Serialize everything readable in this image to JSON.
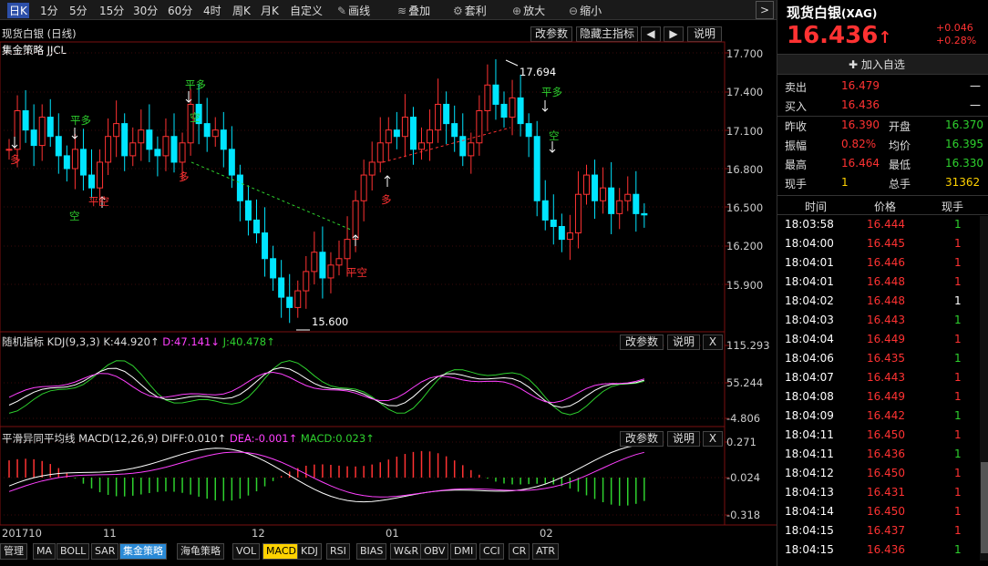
{
  "toolbar": {
    "items": [
      "日K",
      "1分",
      "5分",
      "15分",
      "30分",
      "60分",
      "4时",
      "周K",
      "月K",
      "自定义",
      "画线",
      "叠加",
      "套利",
      "放大",
      "缩小"
    ]
  },
  "title": {
    "name": "现货白银 (日线)",
    "buttons": [
      "改参数",
      "隐藏主指标",
      "◀",
      "▶",
      "说明"
    ]
  },
  "strategy_label": "集金策略 JJCL",
  "price_axis": [
    "17.700",
    "17.400",
    "17.100",
    "16.800",
    "16.500",
    "16.200",
    "15.900"
  ],
  "annotations": {
    "high": "17.694",
    "low": "15.600",
    "pingduo": "平多",
    "pingkong": "平空",
    "duo": "多",
    "kong": "空"
  },
  "kdj": {
    "label": "随机指标",
    "params": "KDJ(9,3,3)",
    "k": "K:44.920↑",
    "d": "D:47.141↓",
    "j": "J:40.478↑",
    "axis": [
      "115.293",
      "55.244",
      "-4.806"
    ],
    "buttons": [
      "改参数",
      "说明",
      "X"
    ]
  },
  "macd": {
    "label": "平滑异同平均线",
    "params": "MACD(12,26,9)",
    "diff": "DIFF:0.010↑",
    "dea": "DEA:-0.001↑",
    "macd": "MACD:0.023↑",
    "axis": [
      "0.271",
      "-0.024",
      "-0.318"
    ],
    "buttons": [
      "改参数",
      "说明",
      "X"
    ]
  },
  "xaxis": [
    "201710",
    "11",
    "12",
    "01",
    "02"
  ],
  "bottom_tabs": [
    "管理",
    "MA",
    "BOLL",
    "SAR",
    "集金策略",
    "海龟策略",
    "VOL",
    "MACD",
    "KDJ",
    "RSI",
    "BIAS",
    "W&R",
    "OBV",
    "DMI",
    "CCI",
    "CR",
    "ATR"
  ],
  "quote": {
    "name": "现货白银",
    "code": "(XAG)",
    "price": "16.436",
    "arrow": "↑",
    "change": "+0.046",
    "pct": "+0.28%",
    "add": "✚ 加入自选",
    "sell_label": "卖出",
    "sell": "16.479",
    "sell_vol": "—",
    "buy_label": "买入",
    "buy": "16.436",
    "buy_vol": "—",
    "stats": [
      [
        "昨收",
        "16.390",
        "开盘",
        "16.370"
      ],
      [
        "振幅",
        "0.82%",
        "均价",
        "16.395"
      ],
      [
        "最高",
        "16.464",
        "最低",
        "16.330"
      ],
      [
        "现手",
        "1",
        "总手",
        "31362"
      ]
    ]
  },
  "ticks_header": [
    "时间",
    "价格",
    "现手"
  ],
  "ticks": [
    [
      "18:03:58",
      "16.444",
      "1"
    ],
    [
      "18:04:00",
      "16.445",
      "1"
    ],
    [
      "18:04:01",
      "16.446",
      "1"
    ],
    [
      "18:04:01",
      "16.448",
      "1"
    ],
    [
      "18:04:02",
      "16.448",
      "1"
    ],
    [
      "18:04:03",
      "16.443",
      "1"
    ],
    [
      "18:04:04",
      "16.449",
      "1"
    ],
    [
      "18:04:06",
      "16.435",
      "1"
    ],
    [
      "18:04:07",
      "16.443",
      "1"
    ],
    [
      "18:04:08",
      "16.449",
      "1"
    ],
    [
      "18:04:09",
      "16.442",
      "1"
    ],
    [
      "18:04:11",
      "16.450",
      "1"
    ],
    [
      "18:04:11",
      "16.436",
      "1"
    ],
    [
      "18:04:12",
      "16.450",
      "1"
    ],
    [
      "18:04:13",
      "16.431",
      "1"
    ],
    [
      "18:04:14",
      "16.450",
      "1"
    ],
    [
      "18:04:15",
      "16.437",
      "1"
    ],
    [
      "18:04:15",
      "16.436",
      "1"
    ]
  ],
  "tick_vol_colors": [
    "green",
    "red",
    "red",
    "red",
    "white",
    "green",
    "red",
    "green",
    "red",
    "red",
    "green",
    "red",
    "green",
    "red",
    "red",
    "red",
    "red",
    "green"
  ],
  "colors": {
    "up": "#ff3232",
    "down": "#00e5ff",
    "k": "#ffffff",
    "d": "#ff40ff",
    "j": "#2ed12e"
  }
}
